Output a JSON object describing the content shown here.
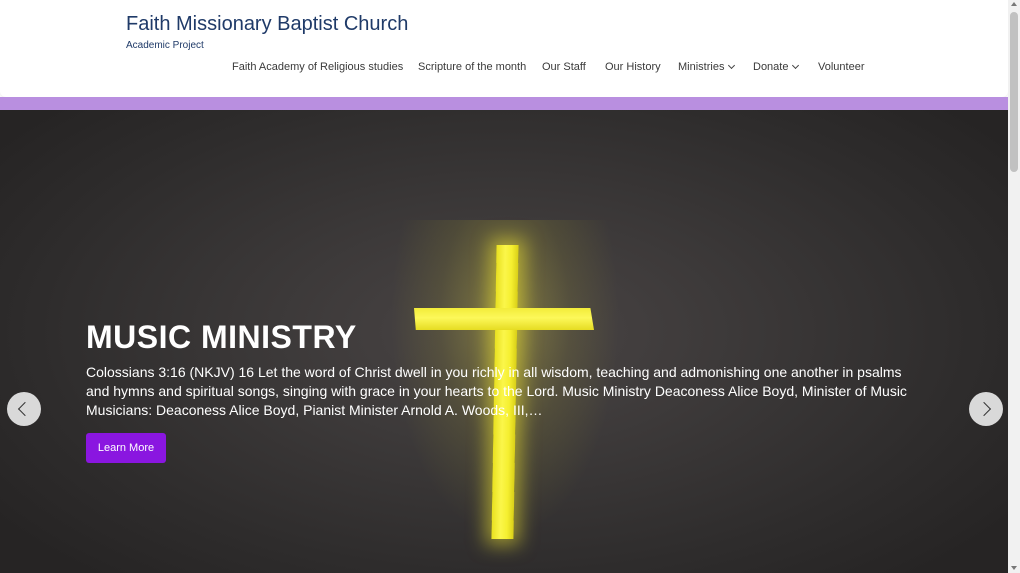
{
  "header": {
    "site_title": "Faith Missionary Baptist Church",
    "tagline": "Academic Project"
  },
  "nav": {
    "items": [
      {
        "label": "Faith Academy of Religious studies",
        "has_dropdown": false
      },
      {
        "label": "Scripture of the month",
        "has_dropdown": false
      },
      {
        "label": "Our Staff",
        "has_dropdown": false
      },
      {
        "label": "Our History",
        "has_dropdown": false
      },
      {
        "label": "Ministries",
        "has_dropdown": true
      },
      {
        "label": "Donate",
        "has_dropdown": true
      },
      {
        "label": "Volunteer",
        "has_dropdown": false
      }
    ]
  },
  "hero": {
    "title": "MUSIC MINISTRY",
    "excerpt": "Colossians 3:16 (NKJV) 16 Let the word of Christ dwell in you richly in all wisdom, teaching and admonishing one another in psalms and hymns and spiritual songs, singing with grace in your hearts to the Lord. Music Ministry Deaconess Alice Boyd, Minister of Music Musicians: Deaconess Alice Boyd, Pianist Minister Arnold A. Woods, III,…",
    "button_label": "Learn More",
    "background_image": "glowing-cross"
  },
  "icons": {
    "prev": "chevron-left-icon",
    "next": "chevron-right-icon",
    "dropdown": "chevron-down-icon"
  },
  "colors": {
    "accent_band": "#b98fe0",
    "button": "#8a16e0",
    "title": "#1f3a68"
  }
}
